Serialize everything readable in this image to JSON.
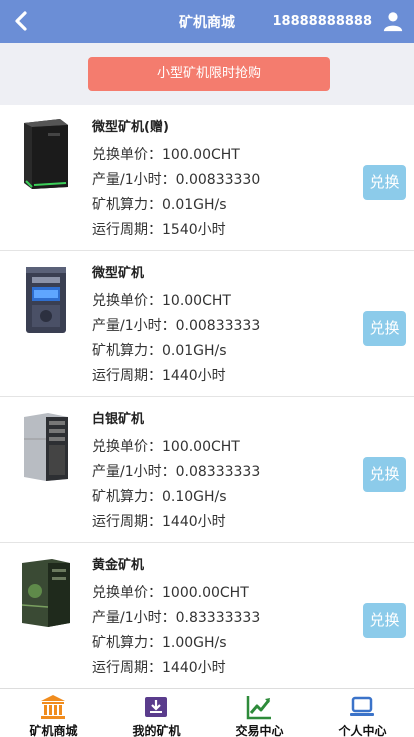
{
  "header": {
    "back_icon": "chevron-left-icon",
    "title": "矿机商城",
    "phone": "18888888888",
    "user_icon": "user-icon"
  },
  "banner": {
    "label": "小型矿机限时抢购"
  },
  "products": [
    {
      "name": "微型矿机(赠)",
      "price": "兑换单价：100.00CHT",
      "output": "产量/1小时：0.00833330",
      "power": "矿机算力：0.01GH/s",
      "cycle": "运行周期：1540小时",
      "button": "兑换"
    },
    {
      "name": "微型矿机",
      "price": "兑换单价：10.00CHT",
      "output": "产量/1小时：0.00833333",
      "power": "矿机算力：0.01GH/s",
      "cycle": "运行周期：1440小时",
      "button": "兑换"
    },
    {
      "name": "白银矿机",
      "price": "兑换单价：100.00CHT",
      "output": "产量/1小时：0.08333333",
      "power": "矿机算力：0.10GH/s",
      "cycle": "运行周期：1440小时",
      "button": "兑换"
    },
    {
      "name": "黄金矿机",
      "price": "兑换单价：1000.00CHT",
      "output": "产量/1小时：0.83333333",
      "power": "矿机算力：1.00GH/s",
      "cycle": "运行周期：1440小时",
      "button": "兑换"
    }
  ],
  "tabbar": {
    "items": [
      {
        "label": "矿机商城",
        "icon": "bank-icon",
        "color": "#f08c1e"
      },
      {
        "label": "我的矿机",
        "icon": "download-box-icon",
        "color": "#5a3c8c"
      },
      {
        "label": "交易中心",
        "icon": "trend-chart-icon",
        "color": "#2e8b3a"
      },
      {
        "label": "个人中心",
        "icon": "laptop-icon",
        "color": "#3b73c9"
      }
    ]
  },
  "colors": {
    "header_bg": "#6b8ed6",
    "promo_bg": "#f47c6e",
    "exchange_bg": "#8ccbea"
  }
}
